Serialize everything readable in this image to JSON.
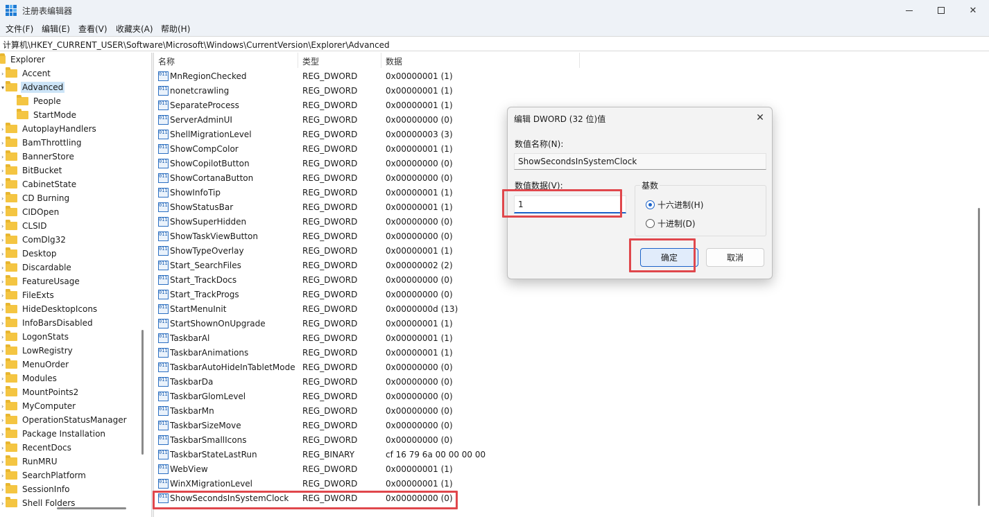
{
  "window": {
    "title": "注册表编辑器",
    "minimize": "",
    "maximize": "",
    "close": "✕"
  },
  "menu": [
    "文件(F)",
    "编辑(E)",
    "查看(V)",
    "收藏夹(A)",
    "帮助(H)"
  ],
  "address": "计算机\\HKEY_CURRENT_USER\\Software\\Microsoft\\Windows\\CurrentVersion\\Explorer\\Advanced",
  "tree": {
    "root": "Explorer",
    "items": [
      {
        "label": "Accent",
        "level": 1
      },
      {
        "label": "Advanced",
        "level": 1,
        "selected": true,
        "expanded": true
      },
      {
        "label": "People",
        "level": 2
      },
      {
        "label": "StartMode",
        "level": 2
      },
      {
        "label": "AutoplayHandlers",
        "level": 1
      },
      {
        "label": "BamThrottling",
        "level": 1
      },
      {
        "label": "BannerStore",
        "level": 1
      },
      {
        "label": "BitBucket",
        "level": 1
      },
      {
        "label": "CabinetState",
        "level": 1
      },
      {
        "label": "CD Burning",
        "level": 1
      },
      {
        "label": "CIDOpen",
        "level": 1
      },
      {
        "label": "CLSID",
        "level": 1
      },
      {
        "label": "ComDlg32",
        "level": 1
      },
      {
        "label": "Desktop",
        "level": 1
      },
      {
        "label": "Discardable",
        "level": 1
      },
      {
        "label": "FeatureUsage",
        "level": 1
      },
      {
        "label": "FileExts",
        "level": 1
      },
      {
        "label": "HideDesktopIcons",
        "level": 1
      },
      {
        "label": "InfoBarsDisabled",
        "level": 1
      },
      {
        "label": "LogonStats",
        "level": 1
      },
      {
        "label": "LowRegistry",
        "level": 1
      },
      {
        "label": "MenuOrder",
        "level": 1
      },
      {
        "label": "Modules",
        "level": 1
      },
      {
        "label": "MountPoints2",
        "level": 1
      },
      {
        "label": "MyComputer",
        "level": 1
      },
      {
        "label": "OperationStatusManager",
        "level": 1
      },
      {
        "label": "Package Installation",
        "level": 1
      },
      {
        "label": "RecentDocs",
        "level": 1
      },
      {
        "label": "RunMRU",
        "level": 1
      },
      {
        "label": "SearchPlatform",
        "level": 1
      },
      {
        "label": "SessionInfo",
        "level": 1
      },
      {
        "label": "Shell Folders",
        "level": 1
      }
    ]
  },
  "list": {
    "columns": [
      "名称",
      "类型",
      "数据"
    ],
    "rows": [
      {
        "name": "MnRegionChecked",
        "type": "REG_DWORD",
        "data": "0x00000001 (1)"
      },
      {
        "name": "nonetcrawling",
        "type": "REG_DWORD",
        "data": "0x00000001 (1)"
      },
      {
        "name": "SeparateProcess",
        "type": "REG_DWORD",
        "data": "0x00000001 (1)"
      },
      {
        "name": "ServerAdminUI",
        "type": "REG_DWORD",
        "data": "0x00000000 (0)"
      },
      {
        "name": "ShellMigrationLevel",
        "type": "REG_DWORD",
        "data": "0x00000003 (3)"
      },
      {
        "name": "ShowCompColor",
        "type": "REG_DWORD",
        "data": "0x00000001 (1)"
      },
      {
        "name": "ShowCopilotButton",
        "type": "REG_DWORD",
        "data": "0x00000000 (0)"
      },
      {
        "name": "ShowCortanaButton",
        "type": "REG_DWORD",
        "data": "0x00000000 (0)"
      },
      {
        "name": "ShowInfoTip",
        "type": "REG_DWORD",
        "data": "0x00000001 (1)"
      },
      {
        "name": "ShowStatusBar",
        "type": "REG_DWORD",
        "data": "0x00000001 (1)"
      },
      {
        "name": "ShowSuperHidden",
        "type": "REG_DWORD",
        "data": "0x00000000 (0)"
      },
      {
        "name": "ShowTaskViewButton",
        "type": "REG_DWORD",
        "data": "0x00000000 (0)"
      },
      {
        "name": "ShowTypeOverlay",
        "type": "REG_DWORD",
        "data": "0x00000001 (1)"
      },
      {
        "name": "Start_SearchFiles",
        "type": "REG_DWORD",
        "data": "0x00000002 (2)"
      },
      {
        "name": "Start_TrackDocs",
        "type": "REG_DWORD",
        "data": "0x00000000 (0)"
      },
      {
        "name": "Start_TrackProgs",
        "type": "REG_DWORD",
        "data": "0x00000000 (0)"
      },
      {
        "name": "StartMenuInit",
        "type": "REG_DWORD",
        "data": "0x0000000d (13)"
      },
      {
        "name": "StartShownOnUpgrade",
        "type": "REG_DWORD",
        "data": "0x00000001 (1)"
      },
      {
        "name": "TaskbarAl",
        "type": "REG_DWORD",
        "data": "0x00000001 (1)"
      },
      {
        "name": "TaskbarAnimations",
        "type": "REG_DWORD",
        "data": "0x00000001 (1)"
      },
      {
        "name": "TaskbarAutoHideInTabletMode",
        "type": "REG_DWORD",
        "data": "0x00000000 (0)"
      },
      {
        "name": "TaskbarDa",
        "type": "REG_DWORD",
        "data": "0x00000000 (0)"
      },
      {
        "name": "TaskbarGlomLevel",
        "type": "REG_DWORD",
        "data": "0x00000000 (0)"
      },
      {
        "name": "TaskbarMn",
        "type": "REG_DWORD",
        "data": "0x00000000 (0)"
      },
      {
        "name": "TaskbarSizeMove",
        "type": "REG_DWORD",
        "data": "0x00000000 (0)"
      },
      {
        "name": "TaskbarSmallIcons",
        "type": "REG_DWORD",
        "data": "0x00000000 (0)"
      },
      {
        "name": "TaskbarStateLastRun",
        "type": "REG_BINARY",
        "data": "cf 16 79 6a 00 00 00 00"
      },
      {
        "name": "WebView",
        "type": "REG_DWORD",
        "data": "0x00000001 (1)"
      },
      {
        "name": "WinXMigrationLevel",
        "type": "REG_DWORD",
        "data": "0x00000001 (1)"
      },
      {
        "name": "ShowSecondsInSystemClock",
        "type": "REG_DWORD",
        "data": "0x00000000 (0)",
        "highlighted": true
      }
    ]
  },
  "dialog": {
    "title": "编辑 DWORD (32 位)值",
    "close": "✕",
    "name_label": "数值名称(N):",
    "name_value": "ShowSecondsInSystemClock",
    "data_label": "数值数据(V):",
    "data_value": "1",
    "base_label": "基数",
    "hex_label": "十六进制(H)",
    "dec_label": "十进制(D)",
    "base_selected": "hex",
    "ok_label": "确定",
    "cancel_label": "取消"
  },
  "colors": {
    "highlight_box": "#e0474c",
    "accent": "#1a62c9",
    "selection": "#cce4f7"
  }
}
